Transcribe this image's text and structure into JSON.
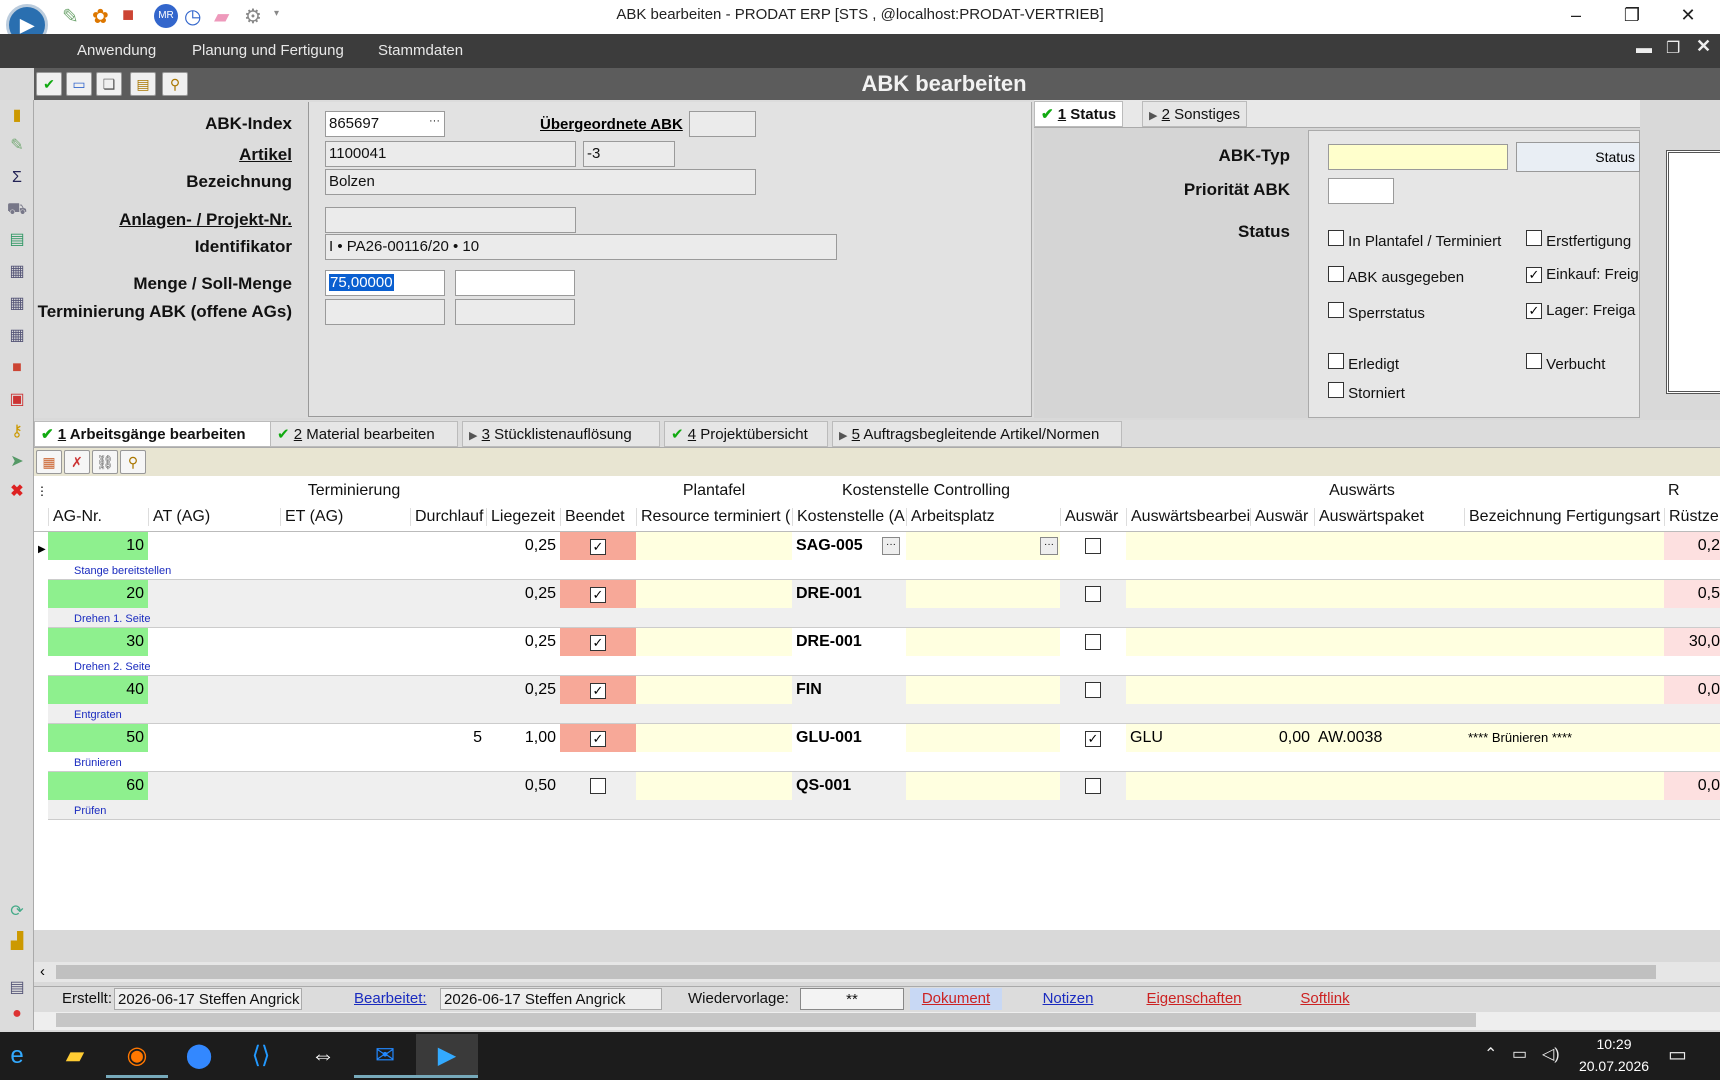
{
  "window": {
    "title": "ABK bearbeiten - PRODAT ERP   [STS ,  @localhost:PRODAT-VERTRIEB]",
    "min": "–",
    "max": "❐",
    "close": "✕"
  },
  "menu": [
    "Anwendung",
    "Planung und Fertigung",
    "Stammdaten"
  ],
  "form_title": "ABK bearbeiten",
  "form": {
    "abk_index_label": "ABK-Index",
    "abk_index": "865697",
    "parent_abk_label": "Übergeordnete ABK",
    "parent_abk": "",
    "artikel_label": "Artikel",
    "artikel": "1100041",
    "artikel_var": "-3",
    "bezeichnung_label": "Bezeichnung",
    "bezeichnung": "Bolzen",
    "projekt_label": "Anlagen- / Projekt-Nr.",
    "projekt": "",
    "ident_label": "Identifikator",
    "ident": "I • PA26-00116/20 • 10",
    "menge_label": "Menge / Soll-Menge",
    "menge": "75,00000",
    "soll_menge": "",
    "term_label": "Terminierung ABK (offene AGs)"
  },
  "right_tabs": [
    {
      "num": "1",
      "label": " Status"
    },
    {
      "num": "2",
      "label": " Sonstiges"
    }
  ],
  "status_panel": {
    "abk_typ_label": "ABK-Typ",
    "prio_label": "Priorität ABK",
    "status_label": "Status",
    "status_btn": "Status",
    "checks": [
      {
        "label": "In Plantafel / Terminiert",
        "checked": false
      },
      {
        "label": "Erstfertigung",
        "checked": false
      },
      {
        "label": "ABK ausgegeben",
        "checked": false
      },
      {
        "label": "Einkauf: Freig",
        "checked": true
      },
      {
        "label": "Sperrstatus",
        "checked": false
      },
      {
        "label": "Lager: Freiga",
        "checked": true
      },
      {
        "label": "Erledigt",
        "checked": false
      },
      {
        "label": "Verbucht",
        "checked": false
      },
      {
        "label": "Storniert",
        "checked": false
      }
    ]
  },
  "bottom_tabs": [
    {
      "num": "1",
      "label": " Arbeitsgänge bearbeiten"
    },
    {
      "num": "2",
      "label": " Material bearbeiten"
    },
    {
      "num": "3",
      "label": " Stücklistenauflösung"
    },
    {
      "num": "4",
      "label": " Projektübersicht"
    },
    {
      "num": "5",
      "label": " Auftragsbegleitende Artikel/Normen"
    }
  ],
  "grid": {
    "groups": [
      "Terminierung",
      "Plantafel",
      "Kostenstelle Controlling",
      "Auswärts",
      "R"
    ],
    "columns": [
      "AG-Nr.",
      "AT (AG)",
      "ET (AG)",
      "Durchlauf",
      "Liegezeit",
      "Beendet",
      "Resource terminiert (",
      "Kostenstelle (A",
      "Arbeitsplatz",
      "Auswär",
      "Auswärtsbearbei",
      "Auswär",
      "Auswärtspaket",
      "Bezeichnung Fertigungsart",
      "Rüstze"
    ],
    "rows": [
      {
        "nr": "10",
        "durch": "",
        "liege": "0,25",
        "beendet": true,
        "kst": "SAG-005",
        "ausw": false,
        "awbear": "",
        "awval": "",
        "awpaket": "",
        "bez": "",
        "ruest": "0,2",
        "desc": "Stange bereitstellen"
      },
      {
        "nr": "20",
        "durch": "",
        "liege": "0,25",
        "beendet": true,
        "kst": "DRE-001",
        "ausw": false,
        "awbear": "",
        "awval": "",
        "awpaket": "",
        "bez": "",
        "ruest": "0,5",
        "desc": "Drehen 1. Seite"
      },
      {
        "nr": "30",
        "durch": "",
        "liege": "0,25",
        "beendet": true,
        "kst": "DRE-001",
        "ausw": false,
        "awbear": "",
        "awval": "",
        "awpaket": "",
        "bez": "",
        "ruest": "30,0",
        "desc": "Drehen 2. Seite"
      },
      {
        "nr": "40",
        "durch": "",
        "liege": "0,25",
        "beendet": true,
        "kst": "FIN",
        "ausw": false,
        "awbear": "",
        "awval": "",
        "awpaket": "",
        "bez": "",
        "ruest": "0,0",
        "desc": "Entgraten"
      },
      {
        "nr": "50",
        "durch": "5",
        "liege": "1,00",
        "beendet": true,
        "kst": "GLU-001",
        "ausw": true,
        "awbear": "GLU",
        "awval": "0,00",
        "awpaket": "AW.0038",
        "bez": "**** Brünieren ****",
        "ruest": "",
        "desc": "Brünieren"
      },
      {
        "nr": "60",
        "durch": "",
        "liege": "0,50",
        "beendet": false,
        "kst": "QS-001",
        "ausw": false,
        "awbear": "",
        "awval": "",
        "awpaket": "",
        "bez": "",
        "ruest": "0,0",
        "desc": "Prüfen"
      }
    ]
  },
  "statusbar": {
    "erstellt_label": "Erstellt:",
    "erstellt": "2026-06-17  Steffen Angrick",
    "bearbeitet_label": "Bearbeitet:",
    "bearbeitet": "2026-06-17  Steffen Angrick",
    "wv_label": "Wiedervorlage:",
    "wv": "**",
    "dokument": "Dokument",
    "notizen": "Notizen",
    "eigenschaften": "Eigenschaften",
    "softlink": "Softlink"
  },
  "taskbar": {
    "time": "10:29",
    "date": "20.07.2026"
  }
}
